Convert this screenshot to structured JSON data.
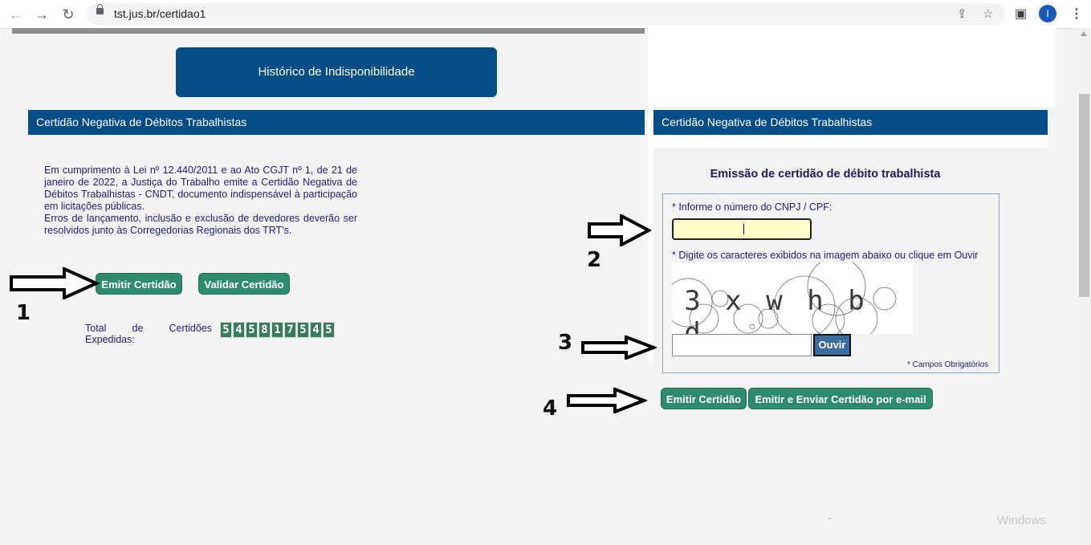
{
  "browser": {
    "url": "tst.jus.br/certidao1",
    "profile_initial": "I",
    "back_icon": "←",
    "forward_icon": "→",
    "reload_icon": "↻",
    "share_icon": "⇪",
    "star_icon": "☆",
    "panel_icon": "▣",
    "menu_icon": "⋮"
  },
  "left": {
    "history_button": "Histórico de Indisponibilidade",
    "header": "Certidão Negativa de Débitos Trabalhistas",
    "intro_p1": "Em cumprimento à Lei nº 12.440/2011 e ao Ato CGJT nº 1, de 21 de janeiro de 2022, a Justiça do Trabalho emite a Certidão Negativa de Débitos Trabalhistas - CNDT, documento indispensável à participação em licitações públicas.",
    "intro_p2": "Erros de lançamento, inclusão e exclusão de devedores deverão ser resolvidos junto às Corregedorias Regionais dos TRT's.",
    "emit_button": "Emitir Certidão",
    "validate_button": "Validar Certidão",
    "total_label_1": "Total de Certidões",
    "total_label_2": "Expedidas:",
    "total_digits": [
      "5",
      "4",
      "5",
      "8",
      "1",
      "7",
      "5",
      "4",
      "5"
    ]
  },
  "right": {
    "header": "Certidão Negativa de Débitos Trabalhistas",
    "form_title": "Emissão de certidão de débito trabalhista",
    "cnpj_label": "* Informe o número do CNPJ / CPF:",
    "cnpj_value": "",
    "captcha_label": "* Digite os caracteres exibidos na imagem abaixo ou clique em Ouvir",
    "captcha_chars": [
      "3",
      "x",
      "w",
      "h",
      "b",
      "d"
    ],
    "captcha_value": "",
    "ouvir_button": "Ouvir",
    "required_note": "* Campos Obrigatórios",
    "emit_button": "Emitir Certidão",
    "emit_email_button": "Emitir e Enviar Certidão por e-mail"
  },
  "annotations": {
    "step1": "1",
    "step2": "2",
    "step3": "3",
    "step4": "4"
  },
  "watermark": "Windows",
  "colors": {
    "primary_blue": "#044d86",
    "button_green": "#2e8b6f",
    "input_yellow": "#ffffcc",
    "text_navy": "#1d1d7a"
  }
}
